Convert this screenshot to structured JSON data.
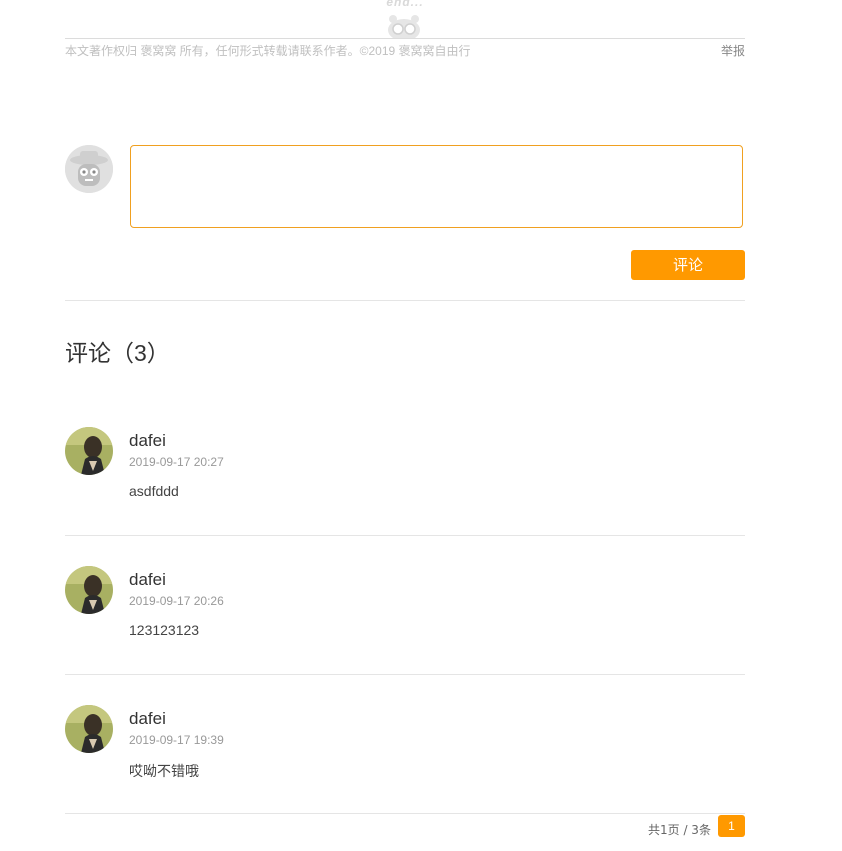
{
  "article_footer": {
    "end_text": "end...",
    "copyright": "本文著作权归 褒窝窝 所有，任何形式转载请联系作者。©2019 褒窝窝自由行",
    "report_label": "举报"
  },
  "composer": {
    "input_value": "",
    "submit_label": "评论"
  },
  "comments_section": {
    "heading": "评论",
    "count_text": "（3）",
    "comments": [
      {
        "author": "dafei",
        "time": "2019-09-17 20:27",
        "text": "asdfddd"
      },
      {
        "author": "dafei",
        "time": "2019-09-17 20:26",
        "text": "123123123"
      },
      {
        "author": "dafei",
        "time": "2019-09-17 19:39",
        "text": "哎呦不错哦"
      }
    ]
  },
  "pagination": {
    "summary": "共1页 / 3条",
    "current_page": "1"
  },
  "colors": {
    "accent": "#ff9900",
    "input_border": "#f0a020"
  }
}
